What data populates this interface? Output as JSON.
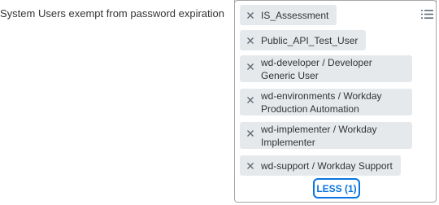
{
  "field": {
    "label": "System Users exempt from password expiration"
  },
  "selected_items": [
    {
      "label": "IS_Assessment"
    },
    {
      "label": "Public_API_Test_User"
    },
    {
      "label": "wd-developer / Developer Generic User"
    },
    {
      "label": "wd-environments / Workday Production Automation"
    },
    {
      "label": "wd-implementer / Workday Implementer"
    },
    {
      "label": "wd-support / Workday Support"
    }
  ],
  "less_button": {
    "label": "LESS (1)"
  },
  "icons": {
    "remove": "close-icon",
    "prompt": "list-prompt-icon"
  },
  "colors": {
    "pill_background": "#e6e9ec",
    "accent": "#0875e1",
    "border": "#a6a6a6"
  }
}
